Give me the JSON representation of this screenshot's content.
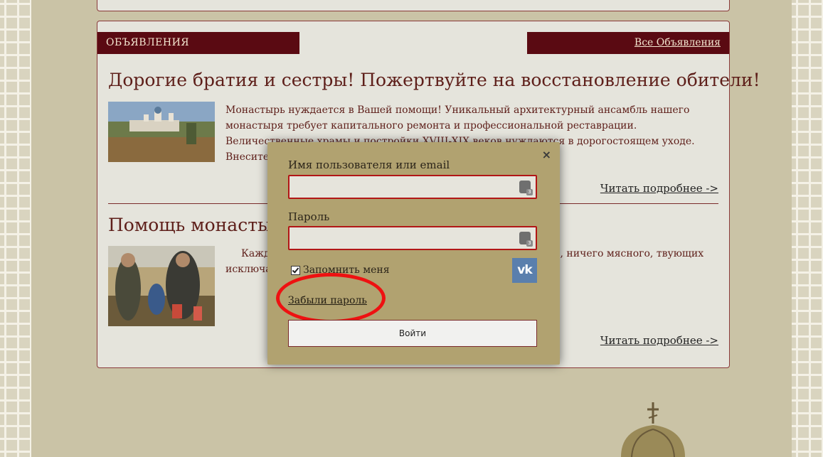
{
  "announcements": {
    "header_label": "ОБЪЯВЛЕНИЯ",
    "all_link": "Все Объявления",
    "posts": [
      {
        "title": "Дорогие братия и сестры! Пожертвуйте на восстановление обители!",
        "text": "Монастырь нуждается в Вашей помощи! Уникальный архитектурный ансамбль нашего монастыря требует капитального ремонта и профессиональной реставрации. Величественные храмы и постройки XVIII-XIX веков нуждаются в дорогостоящем уходе. Внесите посильный вклад в                                                                                     дарениями и пожертвованиями …",
        "read_more": "Читать подробнее ->"
      },
      {
        "title": "Помощь монастырск",
        "text": "Кажд                                                                                                                        рской трапезе, отмечал отменны                                                                                                        ные дни! — Надо же, ничего мясного,                                                                                           твующих исключает мясные продукт                                                                                             выращивает на своем …",
        "read_more": "Читать подробнее ->"
      }
    ]
  },
  "login_modal": {
    "close_icon": "×",
    "username_label": "Имя пользователя или email",
    "password_label": "Пароль",
    "remember_label": "Запомнить меня",
    "remember_checked": true,
    "vk_label": "vk",
    "forgot_label": "Забыли пароль",
    "login_button": "Войти",
    "password_manager_badge": "3"
  },
  "colors": {
    "header_bg": "#5a0a12",
    "panel_bg": "#e5e4dc",
    "modal_bg": "#b1a270",
    "highlight": "#ee1111",
    "vk": "#5a7fad"
  }
}
